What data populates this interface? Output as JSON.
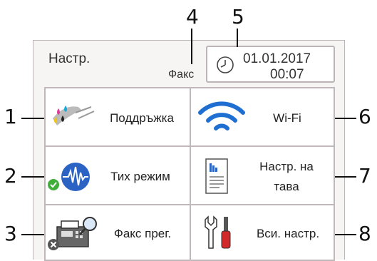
{
  "callouts": {
    "c1": "1",
    "c2": "2",
    "c3": "3",
    "c4": "4",
    "c5": "5",
    "c6": "6",
    "c7": "7",
    "c8": "8"
  },
  "header": {
    "title": "Настр.",
    "mode": "Факс",
    "date": "01.01.2017",
    "time": "00:07"
  },
  "buttons": {
    "maintenance": "Поддръжка",
    "wifi": "Wi-Fi",
    "quiet_mode": "Тих режим",
    "tray_line1": "Настр. на",
    "tray_line2": "тава",
    "fax_preview": "Факс прег.",
    "all_settings": "Вси. настр."
  },
  "icons": {
    "clock": "clock-icon",
    "maintenance": "ink-cartridge-icon",
    "wifi": "wifi-icon",
    "quiet_mode": "quiet-mode-wave-icon",
    "quiet_badge": "check-badge-icon",
    "tray": "paper-tray-document-icon",
    "fax_preview": "fax-machine-magnifier-icon",
    "fax_badge": "close-badge-icon",
    "all_settings": "tools-icon"
  },
  "colors": {
    "wifi": "#1f6fd3",
    "quiet_wave": "#2b63c4",
    "check_badge": "#3fae3a",
    "tools_red": "#d22a2a"
  }
}
